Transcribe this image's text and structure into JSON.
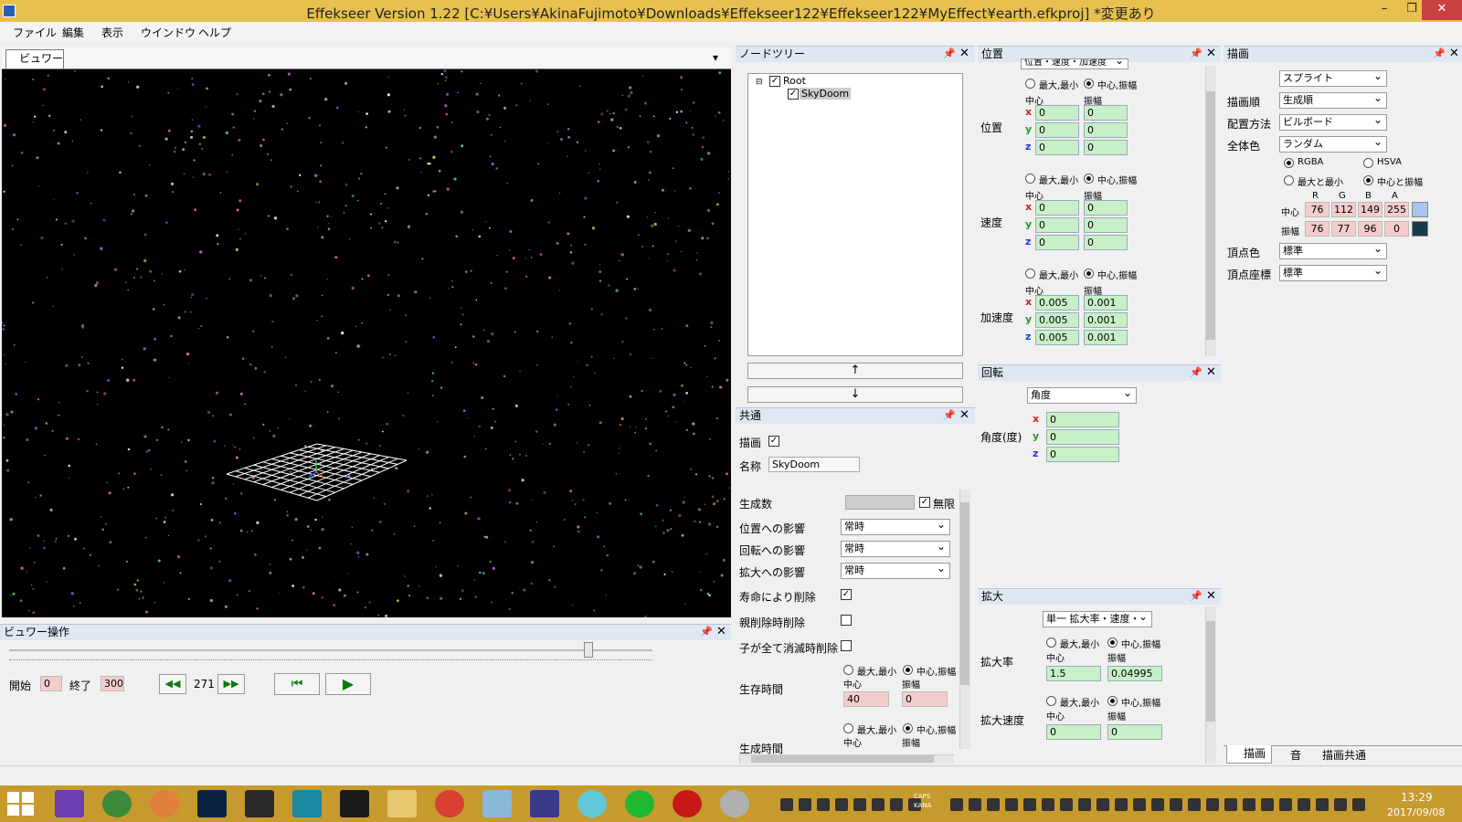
{
  "window": {
    "title": "Effekseer Version 1.22 [C:¥Users¥AkinaFujimoto¥Downloads¥Effekseer122¥Effekseer122¥MyEffect¥earth.efkproj]  *変更あり",
    "min": "–",
    "restore": "❐",
    "close": "✕"
  },
  "menu": [
    "ファイル",
    "編集",
    "表示",
    "ウインドウ",
    "ヘルプ"
  ],
  "viewer": {
    "tab": "ビュワー",
    "dropdown": "▾"
  },
  "viewer_ops": {
    "title": "ビュワー操作",
    "start_label": "開始",
    "start_value": "0",
    "end_label": "終了",
    "end_value": "300",
    "frame": "271",
    "slider_fraction": 0.9,
    "rewind": "◀◀",
    "forward": "▶▶",
    "back_to_start": "⏮",
    "play": "▶"
  },
  "node_tree": {
    "title": "ノードツリー",
    "root": "Root",
    "child": "SkyDoom",
    "up": "↑",
    "down": "↓"
  },
  "common": {
    "title": "共通",
    "draw_label": "描画",
    "name_label": "名称",
    "name_value": "SkyDoom",
    "gen_count": "生成数",
    "infinite": "無限",
    "pos_influence": "位置への影響",
    "rot_influence": "回転への影響",
    "scale_influence": "拡大への影響",
    "pos_value": "常時",
    "rot_value": "常時",
    "scale_value": "常時",
    "del_life": "寿命により削除",
    "del_parent": "親削除時削除",
    "del_children": "子が全て消滅時削除",
    "life": "生存時間",
    "life_center": "40",
    "life_amp": "0",
    "gen_time": "生成時間"
  },
  "labels": {
    "minmax": "最大,最小",
    "center_amp": "中心,振幅",
    "center": "中心",
    "amp": "振幅",
    "x": "x",
    "y": "y",
    "z": "z",
    "pin": "📌",
    "close": "✕"
  },
  "position": {
    "title": "位置",
    "mode": "位置・速度・加速度",
    "sections": [
      {
        "label": "位置",
        "center": [
          "0",
          "0",
          "0"
        ],
        "amp": [
          "0",
          "0",
          "0"
        ]
      },
      {
        "label": "速度",
        "center": [
          "0",
          "0",
          "0"
        ],
        "amp": [
          "0",
          "0",
          "0"
        ]
      },
      {
        "label": "加速度",
        "center": [
          "0.005",
          "0.005",
          "0.005"
        ],
        "amp": [
          "0.001",
          "0.001",
          "0.001"
        ]
      }
    ]
  },
  "rotation": {
    "title": "回転",
    "mode": "角度",
    "label": "角度(度)",
    "values": [
      "0",
      "0",
      "0"
    ]
  },
  "scale": {
    "title": "拡大",
    "mode": "単一 拡大率・速度・",
    "rate_label": "拡大率",
    "rate_center": "1.5",
    "rate_amp": "0.04995",
    "speed_label": "拡大速度",
    "speed_center": "0",
    "speed_amp": "0"
  },
  "render": {
    "title": "描画",
    "type": "スプライト",
    "order_label": "描画順",
    "order": "生成順",
    "placement_label": "配置方法",
    "placement": "ビルボード",
    "color_label": "全体色",
    "color": "ランダム",
    "rgba": "RGBA",
    "hsva": "HSVA",
    "maxmin": "最大と最小",
    "centeramp": "中心と振幅",
    "ch": [
      "R",
      "G",
      "B",
      "A"
    ],
    "center_label": "中心",
    "amp_label": "振幅",
    "center_vals": [
      "76",
      "112",
      "149",
      "255"
    ],
    "amp_vals": [
      "76",
      "77",
      "96",
      "0"
    ],
    "center_swatch": "#a8c4ec",
    "amp_swatch": "#1a3a4c",
    "vertex_color_label": "頂点色",
    "vertex_color": "標準",
    "vertex_coord_label": "頂点座標",
    "vertex_coord": "標準"
  },
  "bottom_tabs": [
    "描画",
    "音",
    "描画共通"
  ],
  "taskbar": {
    "time": "13:29",
    "date": "2017/09/08",
    "caps": "CAPS",
    "kana": "KANA"
  }
}
